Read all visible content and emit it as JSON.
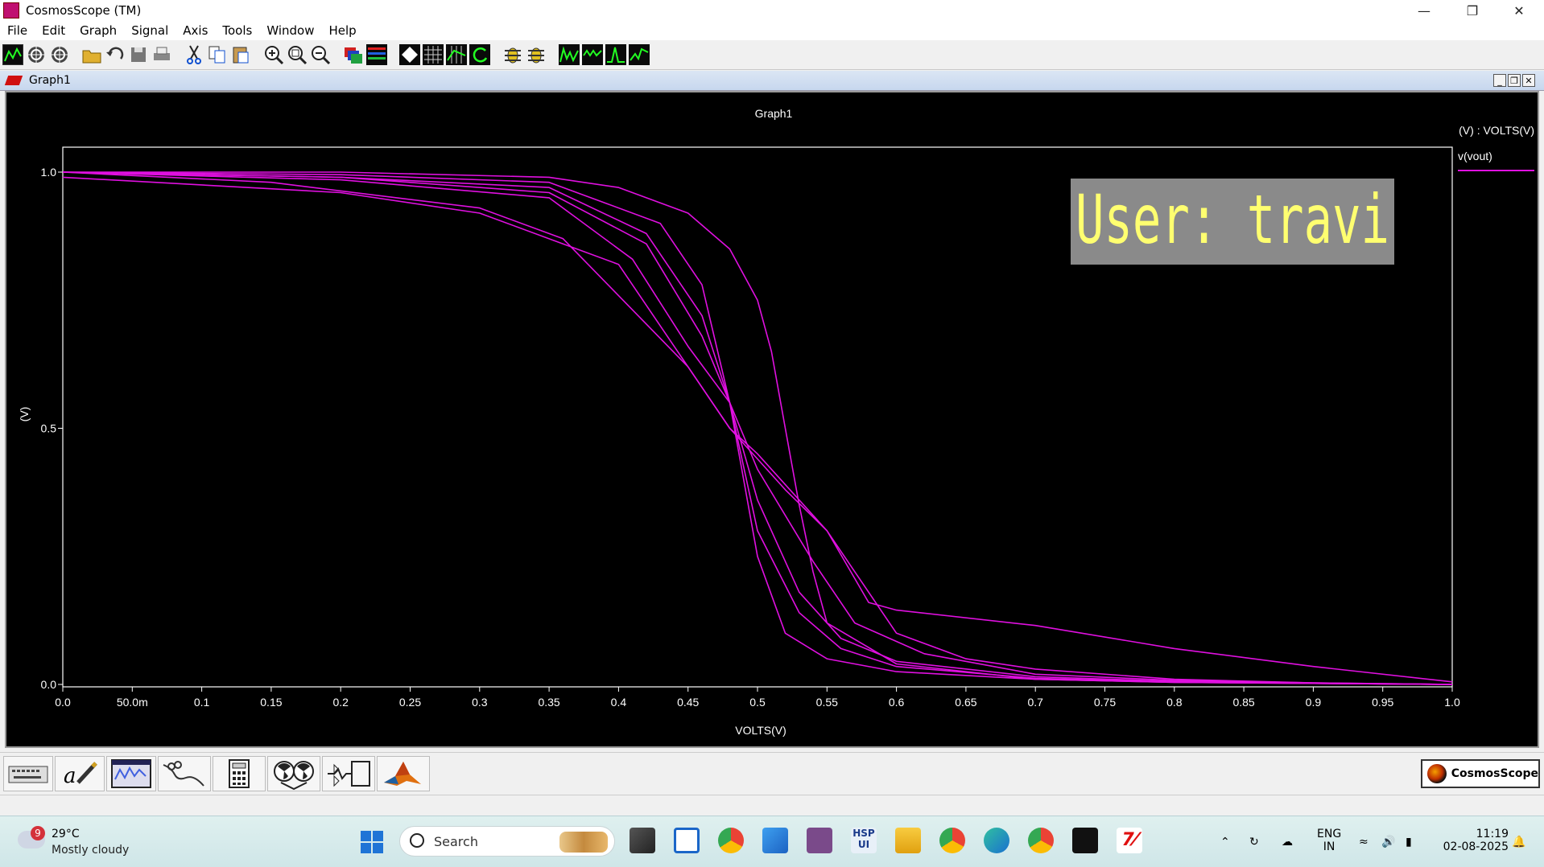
{
  "window": {
    "title": "CosmosScope (TM)"
  },
  "menu": [
    "File",
    "Edit",
    "Graph",
    "Signal",
    "Axis",
    "Tools",
    "Window",
    "Help"
  ],
  "toolbar_icons": [
    "waveform-icon",
    "zoom-cross-icon",
    "zoom-cross2-icon",
    "open-folder-icon",
    "undo-icon",
    "save-icon",
    "print-icon",
    "cut-icon",
    "copy-icon",
    "paste-icon",
    "zoom-in-icon",
    "zoom-fit-icon",
    "zoom-out-icon",
    "stack-icon",
    "color-bars-icon",
    "diamond-icon",
    "grid-icon",
    "grid2-icon",
    "refresh-icon",
    "bug-icon",
    "bug2-icon",
    "wave1-icon",
    "wave2-icon",
    "wave3-icon",
    "wave4-icon"
  ],
  "graph_window": {
    "title": "Graph1"
  },
  "chart_data": {
    "type": "line",
    "title": "Graph1",
    "xlabel": "VOLTS(V)",
    "ylabel": "(V)",
    "xlim": [
      0,
      1.0
    ],
    "ylim": [
      0,
      1.0
    ],
    "x_ticks": [
      "0.0",
      "50.0m",
      "0.1",
      "0.15",
      "0.2",
      "0.25",
      "0.3",
      "0.35",
      "0.4",
      "0.45",
      "0.5",
      "0.55",
      "0.6",
      "0.65",
      "0.7",
      "0.75",
      "0.8",
      "0.85",
      "0.9",
      "0.95",
      "1.0"
    ],
    "y_ticks": [
      "0.0",
      "0.5",
      "1.0"
    ],
    "legend": {
      "header": "(V) : VOLTS(V)",
      "entries": [
        "v(vout)"
      ],
      "placement": "right"
    },
    "line_color": "#e010e0",
    "series": [
      {
        "x": [
          0,
          0.2,
          0.35,
          0.43,
          0.46,
          0.48,
          0.5,
          0.52,
          0.55,
          0.6,
          0.7,
          0.8,
          0.9,
          1.0
        ],
        "y": [
          1.0,
          0.995,
          0.98,
          0.9,
          0.78,
          0.55,
          0.25,
          0.1,
          0.05,
          0.025,
          0.01,
          0.004,
          0.002,
          0.0
        ]
      },
      {
        "x": [
          0,
          0.2,
          0.35,
          0.42,
          0.46,
          0.48,
          0.5,
          0.53,
          0.56,
          0.6,
          0.7,
          0.8,
          0.9,
          1.0
        ],
        "y": [
          1.0,
          0.99,
          0.97,
          0.88,
          0.72,
          0.55,
          0.3,
          0.14,
          0.07,
          0.035,
          0.012,
          0.005,
          0.002,
          0.0
        ]
      },
      {
        "x": [
          0,
          0.2,
          0.35,
          0.42,
          0.46,
          0.48,
          0.5,
          0.53,
          0.56,
          0.6,
          0.7,
          0.8,
          0.9,
          1.0
        ],
        "y": [
          1.0,
          0.99,
          0.96,
          0.86,
          0.68,
          0.55,
          0.36,
          0.18,
          0.09,
          0.045,
          0.015,
          0.006,
          0.002,
          0.0
        ]
      },
      {
        "x": [
          0,
          0.2,
          0.35,
          0.41,
          0.45,
          0.48,
          0.5,
          0.54,
          0.57,
          0.62,
          0.7,
          0.8,
          0.9,
          1.0
        ],
        "y": [
          1.0,
          0.985,
          0.95,
          0.83,
          0.66,
          0.55,
          0.42,
          0.24,
          0.12,
          0.06,
          0.02,
          0.008,
          0.003,
          0.0
        ]
      },
      {
        "x": [
          0,
          0.2,
          0.3,
          0.36,
          0.4,
          0.48,
          0.52,
          0.55,
          0.6,
          0.65,
          0.7,
          0.8,
          0.9,
          1.0
        ],
        "y": [
          0.99,
          0.96,
          0.92,
          0.86,
          0.82,
          0.5,
          0.38,
          0.3,
          0.1,
          0.05,
          0.03,
          0.01,
          0.003,
          0.0
        ]
      },
      {
        "x": [
          0,
          0.15,
          0.3,
          0.36,
          0.45,
          0.48,
          0.5,
          0.55,
          0.58,
          0.6,
          0.7,
          0.8,
          0.9,
          1.0
        ],
        "y": [
          1.0,
          0.98,
          0.93,
          0.87,
          0.62,
          0.5,
          0.45,
          0.3,
          0.16,
          0.145,
          0.115,
          0.07,
          0.035,
          0.005
        ]
      },
      {
        "x": [
          0,
          0.2,
          0.35,
          0.4,
          0.45,
          0.48,
          0.5,
          0.51,
          0.52,
          0.53,
          0.54,
          0.55,
          0.6,
          0.7,
          0.8,
          0.9,
          1.0
        ],
        "y": [
          1.0,
          1.0,
          0.99,
          0.97,
          0.92,
          0.85,
          0.75,
          0.65,
          0.5,
          0.35,
          0.22,
          0.12,
          0.04,
          0.01,
          0.004,
          0.002,
          0.0
        ]
      }
    ]
  },
  "watermark": "User: travi",
  "bottom_tools": [
    "keyboard-icon",
    "pen-icon",
    "waveform-window-icon",
    "scissors-icon",
    "calculator-icon",
    "radiation-icon",
    "schematic-icon",
    "matlab-icon"
  ],
  "brand": "CosmosScope",
  "taskbar": {
    "weather_badge": "9",
    "temperature": "29°C",
    "condition": "Mostly cloudy",
    "search_label": "Search",
    "lang": "ENG",
    "region": "IN",
    "time": "11:19",
    "date": "02-08-2025",
    "colors": {
      "windows_blue": "#1f74d6"
    }
  }
}
